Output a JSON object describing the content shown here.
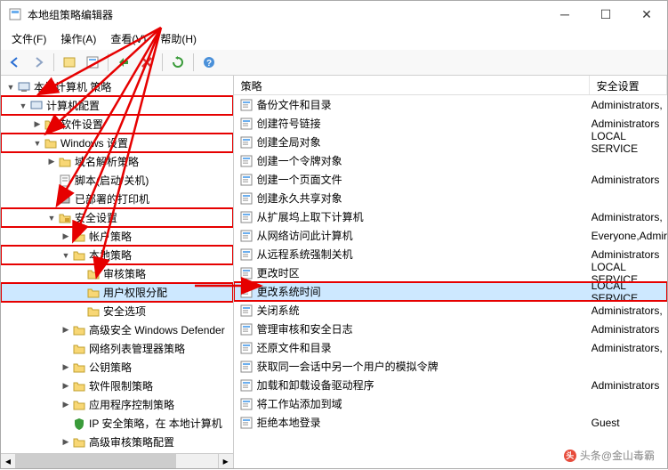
{
  "window": {
    "title": "本地组策略编辑器"
  },
  "menu": {
    "file": "文件(F)",
    "action": "操作(A)",
    "view": "查看(V)",
    "help": "帮助(H)"
  },
  "tree": {
    "root": "本地计算机 策略",
    "computer_config": "计算机配置",
    "software_settings": "软件设置",
    "windows_settings": "Windows 设置",
    "name_resolution": "域名解析策略",
    "scripts": "脚本(启动/关机)",
    "deployed_printers": "已部署的打印机",
    "security_settings": "安全设置",
    "account_policies": "帐户策略",
    "local_policies": "本地策略",
    "audit_policy": "审核策略",
    "user_rights": "用户权限分配",
    "security_options": "安全选项",
    "defender": "高级安全 Windows Defender",
    "network_list": "网络列表管理器策略",
    "public_key": "公钥策略",
    "software_restriction": "软件限制策略",
    "app_control": "应用程序控制策略",
    "ipsec": "IP 安全策略，在 本地计算机",
    "advanced_audit": "高级审核策略配置"
  },
  "columns": {
    "policy": "策略",
    "security_setting": "安全设置"
  },
  "policies": [
    {
      "name": "备份文件和目录",
      "setting": "Administrators,"
    },
    {
      "name": "创建符号链接",
      "setting": "Administrators"
    },
    {
      "name": "创建全局对象",
      "setting": "LOCAL SERVICE"
    },
    {
      "name": "创建一个令牌对象",
      "setting": ""
    },
    {
      "name": "创建一个页面文件",
      "setting": "Administrators"
    },
    {
      "name": "创建永久共享对象",
      "setting": ""
    },
    {
      "name": "从扩展坞上取下计算机",
      "setting": "Administrators,"
    },
    {
      "name": "从网络访问此计算机",
      "setting": "Everyone,Admir"
    },
    {
      "name": "从远程系统强制关机",
      "setting": "Administrators"
    },
    {
      "name": "更改时区",
      "setting": "LOCAL SERVICE"
    },
    {
      "name": "更改系统时间",
      "setting": "LOCAL SERVICE"
    },
    {
      "name": "关闭系统",
      "setting": "Administrators,"
    },
    {
      "name": "管理审核和安全日志",
      "setting": "Administrators"
    },
    {
      "name": "还原文件和目录",
      "setting": "Administrators,"
    },
    {
      "name": "获取同一会话中另一个用户的模拟令牌",
      "setting": ""
    },
    {
      "name": "加载和卸载设备驱动程序",
      "setting": "Administrators"
    },
    {
      "name": "将工作站添加到域",
      "setting": ""
    },
    {
      "name": "拒绝本地登录",
      "setting": "Guest"
    }
  ],
  "watermark": "头条@金山毒霸"
}
